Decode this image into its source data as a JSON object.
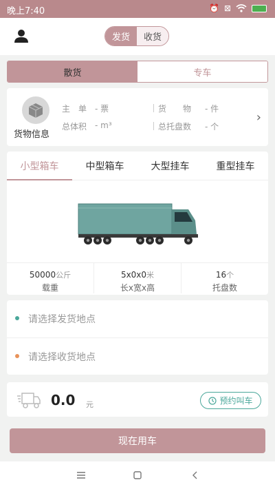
{
  "status_bar": {
    "time": "晚上7:40"
  },
  "header": {
    "segments": [
      "发货",
      "收货"
    ]
  },
  "mode_tabs": [
    "散货",
    "专车"
  ],
  "goods": {
    "label": "货物信息",
    "fields": [
      {
        "name": "主　单",
        "value": "- 票"
      },
      {
        "name": "货　　物",
        "value": "- 件"
      },
      {
        "name": "总体积",
        "value": "- m³"
      },
      {
        "name": "总托盘数",
        "value": "- 个"
      }
    ]
  },
  "vehicle_tabs": [
    "小型箱车",
    "中型箱车",
    "大型挂车",
    "重型挂车"
  ],
  "specs": [
    {
      "value": "50000",
      "unit": "公斤",
      "label": "载重"
    },
    {
      "value": "5x0x0",
      "unit": "米",
      "label": "长x宽x高"
    },
    {
      "value": "16",
      "unit": "个",
      "label": "托盘数"
    }
  ],
  "address": {
    "pickup_placeholder": "请选择发货地点",
    "delivery_placeholder": "请选择收货地点"
  },
  "price": {
    "value": "0.0",
    "unit": "元",
    "reserve_label": "预约叫车"
  },
  "use_now_label": "现在用车",
  "colors": {
    "accent": "#c19599",
    "teal": "#4aa79a",
    "orange": "#e8925a"
  }
}
